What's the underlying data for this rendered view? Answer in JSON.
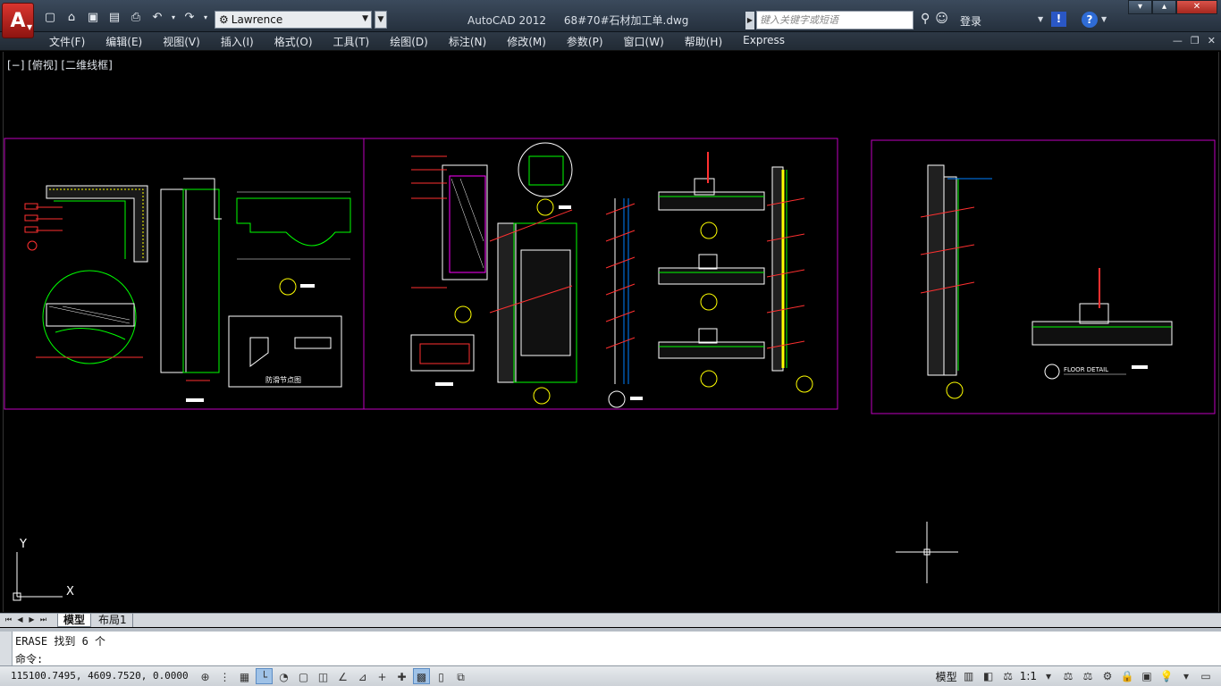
{
  "app": {
    "logo_letter": "A",
    "workspace": "Lawrence",
    "product": "AutoCAD 2012",
    "filename": "68#70#石材加工单.dwg"
  },
  "qat": {
    "icons": [
      "new-icon",
      "open-icon",
      "save-icon",
      "save-as-icon",
      "print-icon",
      "undo-icon",
      "redo-icon"
    ]
  },
  "search": {
    "placeholder": "键入关键字或短语"
  },
  "account": {
    "login_label": "登录"
  },
  "menu": {
    "items": [
      "文件(F)",
      "编辑(E)",
      "视图(V)",
      "插入(I)",
      "格式(O)",
      "工具(T)",
      "绘图(D)",
      "标注(N)",
      "修改(M)",
      "参数(P)",
      "窗口(W)",
      "帮助(H)",
      "Express"
    ]
  },
  "viewport": {
    "label": "[−] [俯视] [二维线框]"
  },
  "drawing": {
    "detail_title_1": "防滑节点图",
    "detail_title_2": "FLOOR DETAIL",
    "ucs_x": "X",
    "ucs_y": "Y"
  },
  "tabs": {
    "model": "模型",
    "layout1": "布局1"
  },
  "command": {
    "history": "ERASE 找到 6 个",
    "prompt": "命令:"
  },
  "status": {
    "coordinates": "115100.7495,  4609.7520, 0.0000",
    "model_label": "模型",
    "scale": "1:1",
    "colors": {
      "cad_red": "#ff0000",
      "cad_green": "#00ff00",
      "cad_magenta": "#ff00ff",
      "cad_yellow": "#ffff00",
      "cad_white": "#ffffff"
    }
  }
}
